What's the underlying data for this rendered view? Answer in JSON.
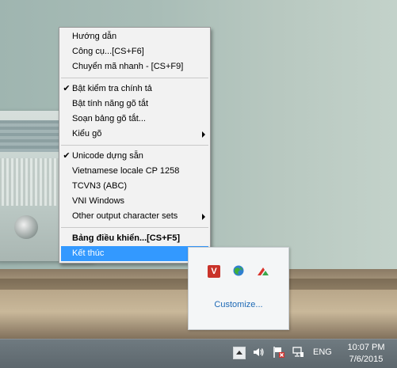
{
  "menu": {
    "items": [
      {
        "label": "Hướng dẫn"
      },
      {
        "label": "Công cụ...[CS+F6]"
      },
      {
        "label": "Chuyển mã nhanh - [CS+F9]"
      },
      {
        "label": "Bật kiểm tra chính tả",
        "checked": true
      },
      {
        "label": "Bật tính năng gõ tắt"
      },
      {
        "label": "Soạn bảng gõ tắt..."
      },
      {
        "label": "Kiểu gõ",
        "submenu": true
      },
      {
        "label": "Unicode dựng sẵn",
        "checked": true
      },
      {
        "label": "Vietnamese locale CP 1258"
      },
      {
        "label": "TCVN3 (ABC)"
      },
      {
        "label": "VNI Windows"
      },
      {
        "label": "Other output character sets",
        "submenu": true
      },
      {
        "label": "Bảng điều khiển...[CS+F5]",
        "bold": true
      },
      {
        "label": "Kết thúc",
        "highlighted": true
      }
    ],
    "check_glyph": "✔"
  },
  "tray_popup": {
    "icons": [
      "unikey-v-icon",
      "network-globe-icon",
      "red-green-arrow-icon"
    ],
    "v_letter": "V",
    "customize_label": "Customize..."
  },
  "taskbar": {
    "icons": [
      "show-hidden-icons-button",
      "speaker-icon",
      "action-center-flag-icon",
      "network-icon"
    ],
    "language": "ENG",
    "time": "10:07 PM",
    "date": "7/6/2015"
  },
  "colors": {
    "menu_highlight": "#3399ff",
    "link": "#1d69b5",
    "taskbar": "#5d676d"
  }
}
